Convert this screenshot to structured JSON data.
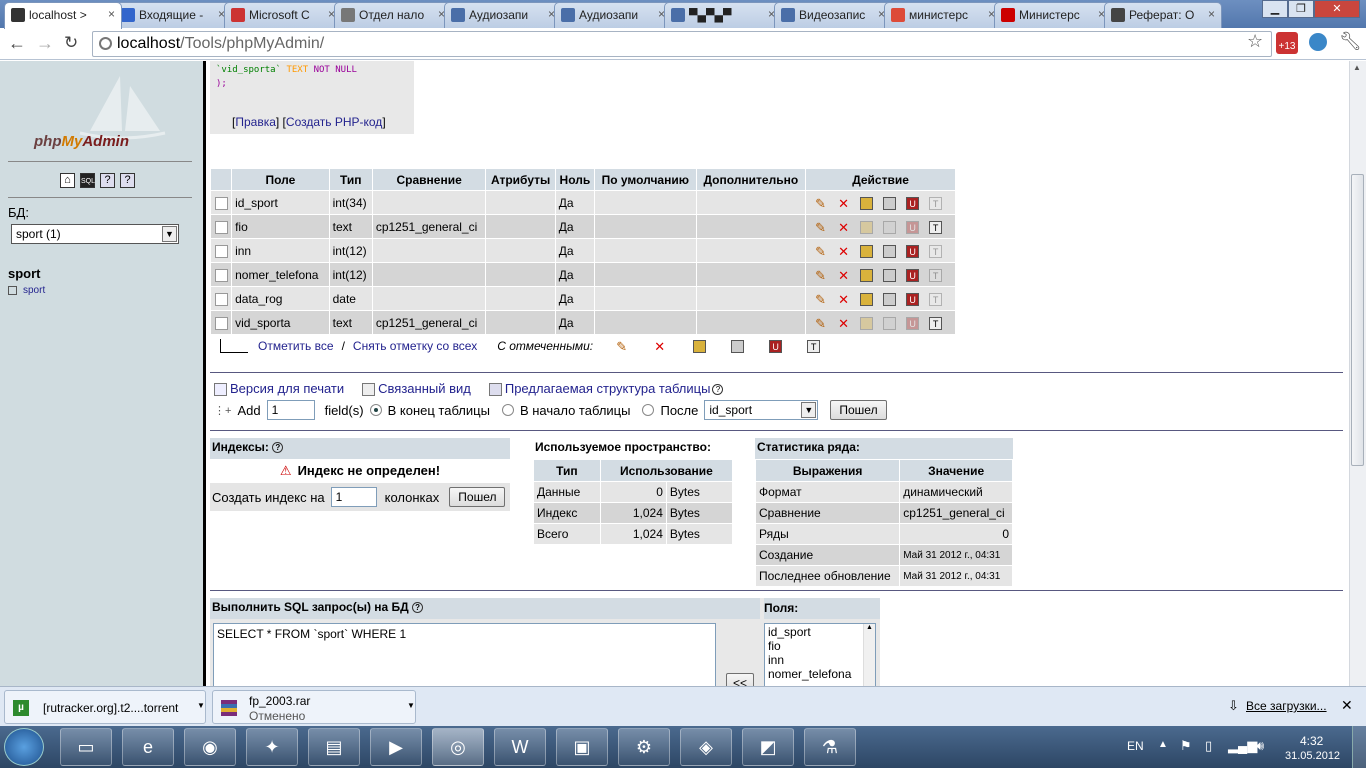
{
  "browser": {
    "tabs": [
      {
        "label": "localhost >",
        "icon": "phpmyadmin-icon",
        "color": "#333333",
        "active": true
      },
      {
        "label": "Входящие -",
        "icon": "mail-icon",
        "color": "#3366cc"
      },
      {
        "label": "Microsoft C",
        "icon": "ms-icon",
        "color": "#cc3333"
      },
      {
        "label": "Отдел нало",
        "icon": "globe-icon",
        "color": "#777777"
      },
      {
        "label": "Аудиозапи",
        "icon": "pause-icon",
        "color": "#4a6ea8"
      },
      {
        "label": "Аудиозапи",
        "icon": "play-icon",
        "color": "#4a6ea8"
      },
      {
        "label": "▀▄▀▄▀",
        "icon": "vk-icon",
        "color": "#4a6ea8"
      },
      {
        "label": "Видеозапис",
        "icon": "vk-icon",
        "color": "#4a6ea8"
      },
      {
        "label": "министерс",
        "icon": "google-icon",
        "color": "#dd4b39"
      },
      {
        "label": "Министерс",
        "icon": "flag-icon",
        "color": "#cc0000"
      },
      {
        "label": "Реферат: О",
        "icon": "hat-icon",
        "color": "#444444"
      }
    ],
    "address": {
      "host": "localhost",
      "path": "/Tools/phpMyAdmin/"
    },
    "ext_badge": "+13"
  },
  "sidebar": {
    "logo": "phpMyAdmin",
    "db_label": "БД:",
    "db_selected": "sport (1)",
    "db_name": "sport",
    "tables": [
      "sport"
    ]
  },
  "sql_preview": {
    "line1": "`vid_sporta` TEXT NOT NULL",
    "line2": ");",
    "edit_link": "Правка",
    "php_link": "Создать PHP-код"
  },
  "structure": {
    "headers": [
      "Поле",
      "Тип",
      "Сравнение",
      "Атрибуты",
      "Ноль",
      "По умолчанию",
      "Дополнительно",
      "Действие"
    ],
    "rows": [
      {
        "field": "id_sport",
        "type": "int(34)",
        "collation": "",
        "attributes": "",
        "null": "Да",
        "default": "",
        "extra": ""
      },
      {
        "field": "fio",
        "type": "text",
        "collation": "cp1251_general_ci",
        "attributes": "",
        "null": "Да",
        "default": "",
        "extra": ""
      },
      {
        "field": "inn",
        "type": "int(12)",
        "collation": "",
        "attributes": "",
        "null": "Да",
        "default": "",
        "extra": ""
      },
      {
        "field": "nomer_telefona",
        "type": "int(12)",
        "collation": "",
        "attributes": "",
        "null": "Да",
        "default": "",
        "extra": ""
      },
      {
        "field": "data_rog",
        "type": "date",
        "collation": "",
        "attributes": "",
        "null": "Да",
        "default": "",
        "extra": ""
      },
      {
        "field": "vid_sporta",
        "type": "text",
        "collation": "cp1251_general_ci",
        "attributes": "",
        "null": "Да",
        "default": "",
        "extra": ""
      }
    ],
    "check_all": "Отметить все",
    "sep": "/",
    "uncheck_all": "Снять отметку со всех",
    "with_selected": "С отмеченными:"
  },
  "links": {
    "print": "Версия для печати",
    "relation": "Связанный вид",
    "propose": "Предлагаемая структура таблицы"
  },
  "addfield": {
    "label": "Add",
    "count": "1",
    "fields": "field(s)",
    "at_end": "В конец таблицы",
    "at_begin": "В начало таблицы",
    "after": "После",
    "after_field": "id_sport",
    "go": "Пошел"
  },
  "indexes": {
    "title": "Индексы:",
    "warning": "Индекс не определен!",
    "create_label": "Создать индекс на",
    "cols": "1",
    "cols_label": "колонках",
    "go": "Пошел"
  },
  "space": {
    "title": "Используемое пространство:",
    "headers": [
      "Тип",
      "Использование"
    ],
    "rows": [
      {
        "type": "Данные",
        "value": "0",
        "unit": "Bytes"
      },
      {
        "type": "Индекс",
        "value": "1,024",
        "unit": "Bytes"
      },
      {
        "type": "Всего",
        "value": "1,024",
        "unit": "Bytes"
      }
    ]
  },
  "rowstats": {
    "title": "Статистика ряда:",
    "headers": [
      "Выражения",
      "Значение"
    ],
    "rows": [
      {
        "k": "Формат",
        "v": "динамический"
      },
      {
        "k": "Сравнение",
        "v": "cp1251_general_ci"
      },
      {
        "k": "Ряды",
        "v": "0"
      },
      {
        "k": "Создание",
        "v": "Май 31 2012 г., 04:31"
      },
      {
        "k": "Последнее обновление",
        "v": "Май 31 2012 г., 04:31"
      }
    ]
  },
  "sqlbox": {
    "title": "Выполнить SQL запрос(ы) на БД",
    "query": "SELECT * FROM `sport` WHERE 1",
    "fields_label": "Поля:",
    "fields": [
      "id_sport",
      "fio",
      "inn",
      "nomer_telefona"
    ],
    "insert_btn": "<<"
  },
  "downloads": {
    "items": [
      {
        "name": "[rutracker.org].t2....torrent",
        "status": ""
      },
      {
        "name": "fp_2003.rar",
        "status": "Отменено"
      }
    ],
    "all": "Все загрузки..."
  },
  "taskbar": {
    "lang": "EN",
    "time": "4:32",
    "date": "31.05.2012"
  }
}
